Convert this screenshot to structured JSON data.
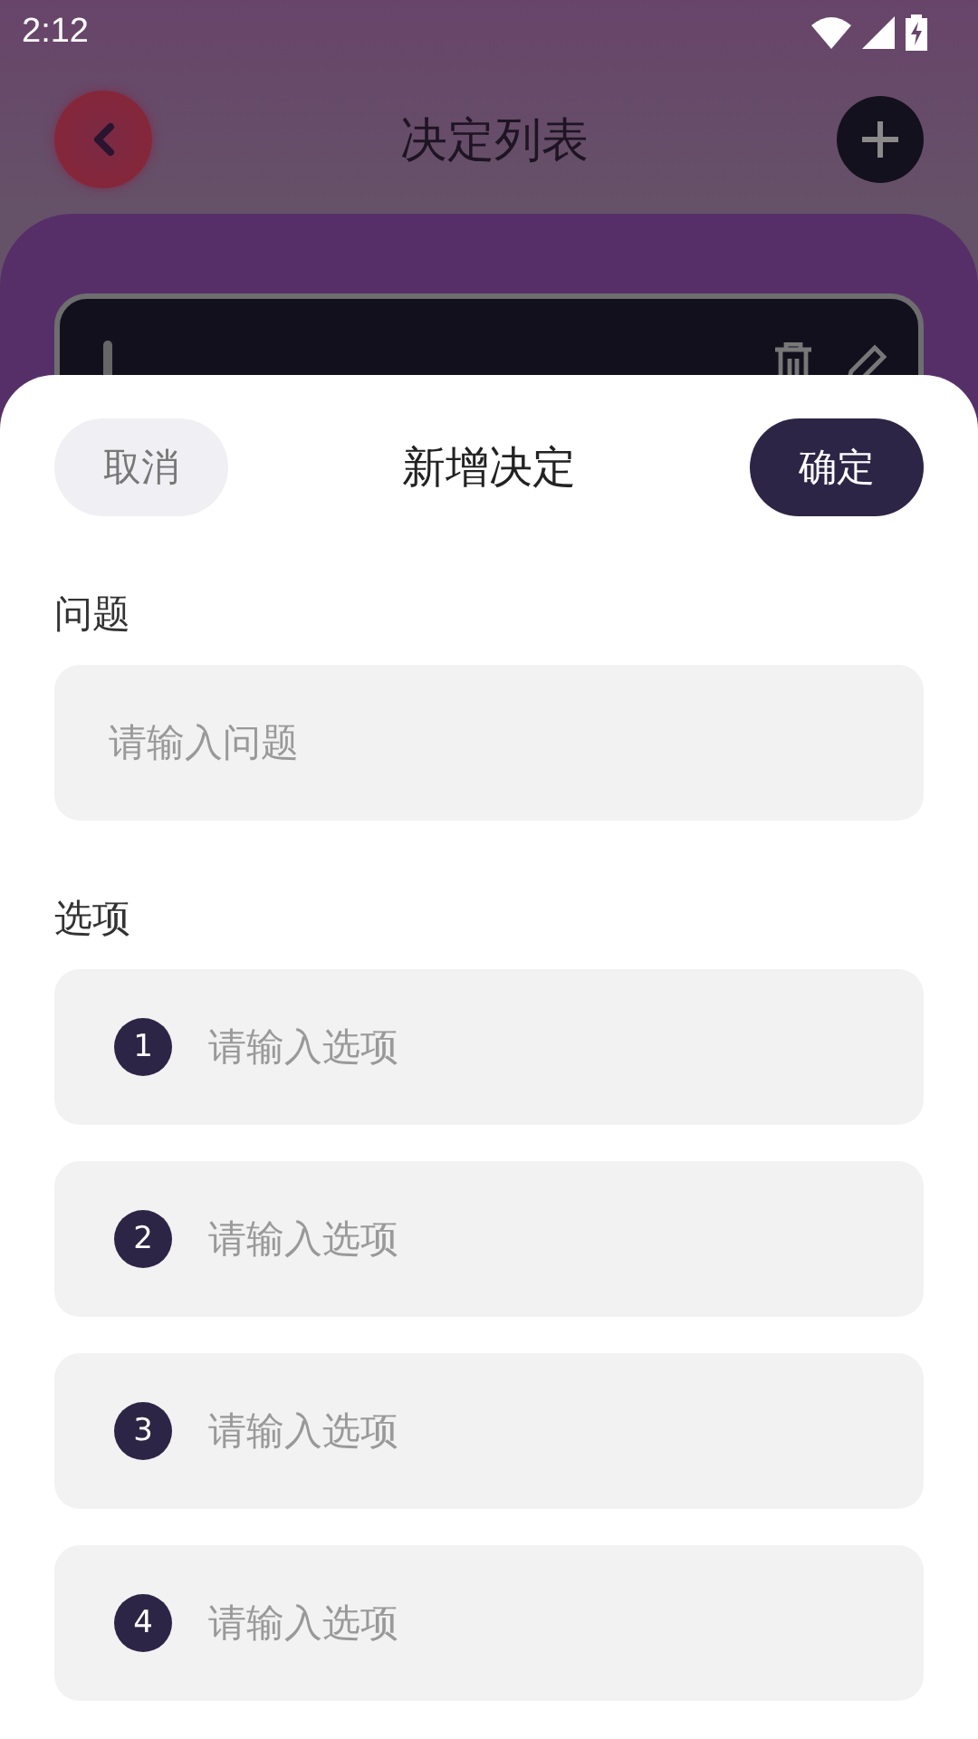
{
  "status_bar": {
    "time": "2:12"
  },
  "header": {
    "title": "决定列表"
  },
  "sheet": {
    "title": "新增决定",
    "cancel": "取消",
    "confirm": "确定",
    "question": {
      "label": "问题",
      "placeholder": "请输入问题"
    },
    "options_label": "选项",
    "options": [
      {
        "number": "1",
        "placeholder": "请输入选项"
      },
      {
        "number": "2",
        "placeholder": "请输入选项"
      },
      {
        "number": "3",
        "placeholder": "请输入选项"
      },
      {
        "number": "4",
        "placeholder": "请输入选项"
      }
    ]
  }
}
